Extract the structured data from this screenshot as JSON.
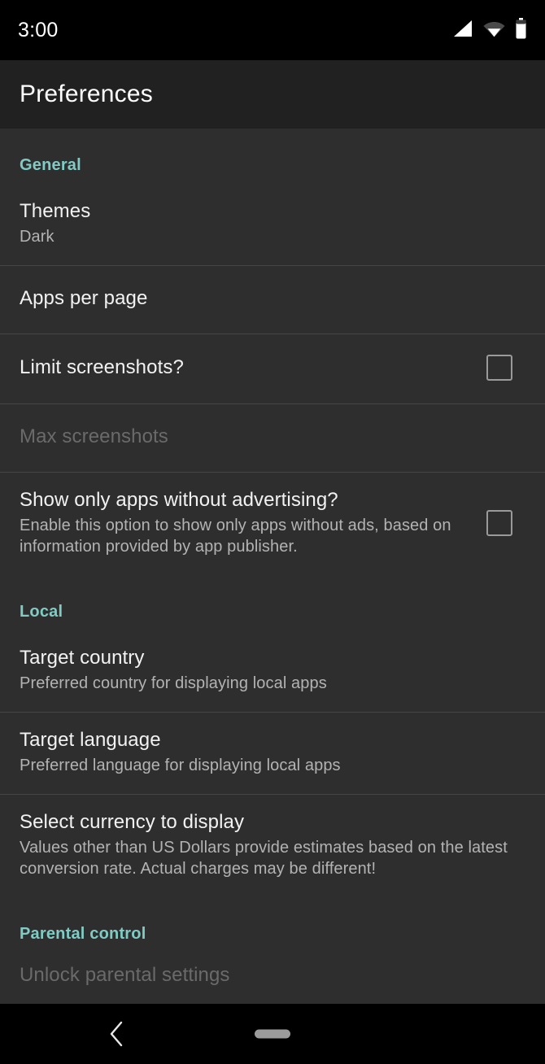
{
  "status_bar": {
    "time": "3:00",
    "icons": [
      "signal-icon",
      "wifi-icon",
      "battery-icon"
    ]
  },
  "toolbar": {
    "title": "Preferences"
  },
  "colors": {
    "accent": "#80cbc4",
    "toolbar_bg": "#212121",
    "content_bg": "#2e2e2e",
    "system_bar_bg": "#000000",
    "divider": "#464646",
    "title_text": "#f2f2f2",
    "summary_text": "#b3b3b3",
    "disabled_text": "#6a6a6a"
  },
  "sections": [
    {
      "header": "General",
      "items": [
        {
          "title": "Themes",
          "summary": "Dark",
          "checkbox": null,
          "disabled": false,
          "divider": false
        },
        {
          "title": "Apps per page",
          "summary": "",
          "checkbox": null,
          "disabled": false,
          "divider": true
        },
        {
          "title": "Limit screenshots?",
          "summary": "",
          "checkbox": "unchecked",
          "disabled": false,
          "divider": true
        },
        {
          "title": "Max screenshots",
          "summary": "",
          "checkbox": null,
          "disabled": true,
          "divider": true
        },
        {
          "title": "Show only apps without advertising?",
          "summary": "Enable this option to show only apps without ads, based on information provided by app publisher.",
          "checkbox": "unchecked",
          "disabled": false,
          "divider": true
        }
      ]
    },
    {
      "header": "Local",
      "items": [
        {
          "title": "Target country",
          "summary": "Preferred country for displaying local apps",
          "checkbox": null,
          "disabled": false,
          "divider": false
        },
        {
          "title": "Target language",
          "summary": "Preferred language for displaying local apps",
          "checkbox": null,
          "disabled": false,
          "divider": true
        },
        {
          "title": "Select currency to display",
          "summary": "Values other than US Dollars provide estimates based on the latest conversion rate. Actual charges may be different!",
          "checkbox": null,
          "disabled": false,
          "divider": true
        }
      ]
    },
    {
      "header": "Parental control",
      "items": [
        {
          "title": "Unlock parental settings",
          "summary": "",
          "checkbox": null,
          "disabled": true,
          "divider": false
        }
      ]
    }
  ],
  "nav_bar": {
    "back_label": "back-icon",
    "home_label": "home-handle"
  }
}
